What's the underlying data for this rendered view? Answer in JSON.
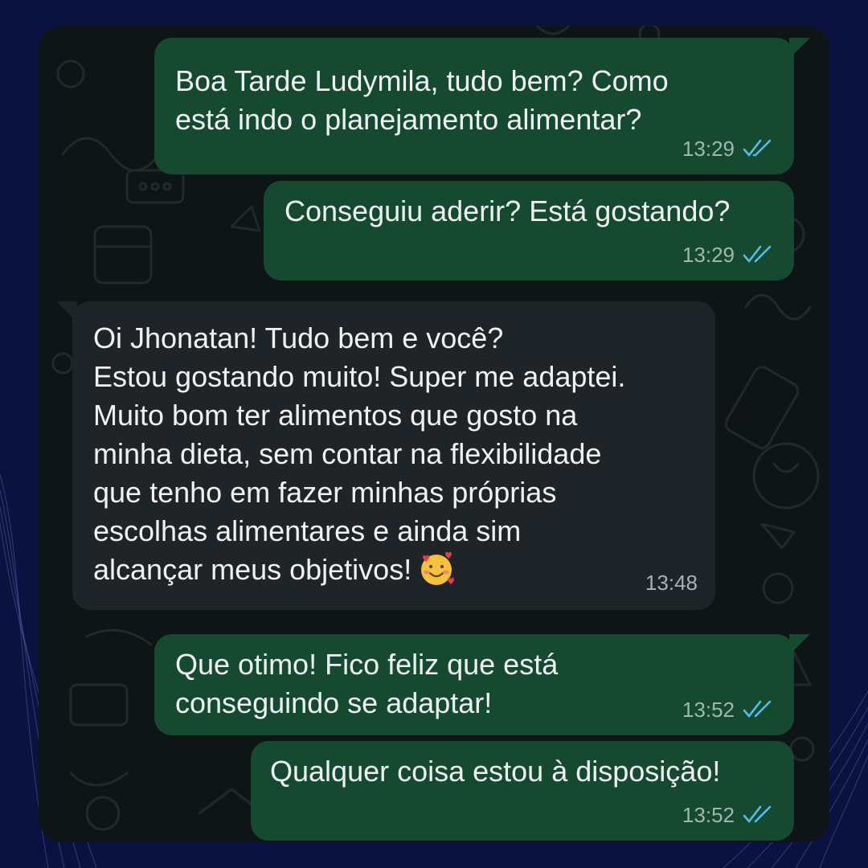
{
  "colors": {
    "page_background": "#0b1240",
    "chat_background": "#0f1416",
    "outgoing_bubble": "#154a31",
    "incoming_bubble": "#1e2428",
    "read_ticks": "#53bdeb"
  },
  "messages": [
    {
      "direction": "outgoing",
      "text": "Boa Tarde Ludymila, tudo bem? Como\nestá indo o planejamento alimentar?",
      "time": "13:29",
      "status_icon": "double-check-read-icon"
    },
    {
      "direction": "outgoing",
      "text": "Conseguiu aderir? Está gostando?",
      "time": "13:29",
      "status_icon": "double-check-read-icon"
    },
    {
      "direction": "incoming",
      "text": "Oi Jhonatan! Tudo bem e você?\nEstou gostando muito! Super me adaptei.\nMuito bom ter alimentos que gosto na\nminha dieta, sem contar na flexibilidade\nque tenho em fazer minhas próprias\nescolhas alimentares e ainda sim\nalcançar meus objetivos!",
      "emoji": "smiling-face-with-hearts-icon",
      "time": "13:48"
    },
    {
      "direction": "outgoing",
      "text": "Que otimo! Fico feliz que está\nconseguindo se adaptar!",
      "time": "13:52",
      "status_icon": "double-check-read-icon"
    },
    {
      "direction": "outgoing",
      "text": "Qualquer coisa estou à disposição!",
      "time": "13:52",
      "status_icon": "double-check-read-icon"
    }
  ]
}
